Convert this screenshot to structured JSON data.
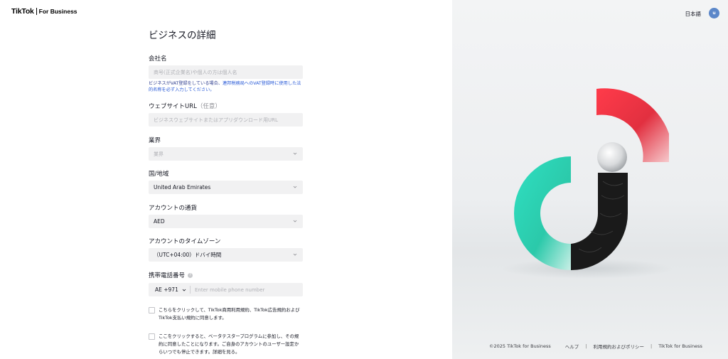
{
  "header": {
    "brand": "TikTok",
    "brand_suffix": "For Business"
  },
  "form": {
    "title": "ビジネスの詳細",
    "company": {
      "label": "会社名",
      "placeholder": "商号(正式企業名)や個人の方は個人名",
      "hint_prefix": "ビジネスがVAT登録をしている場合、",
      "hint_link": "連邦税務局へのVAT登録時に使用",
      "hint_suffix": "した法的名称を必ず入力してください。"
    },
    "website": {
      "label": "ウェブサイトURL",
      "optional": "（任意）",
      "placeholder": "ビジネスウェブサイトまたはアプリダウンロード用URL"
    },
    "industry": {
      "label": "業界",
      "placeholder": "業界"
    },
    "country": {
      "label": "国/地域",
      "value": "United Arab Emirates"
    },
    "currency": {
      "label": "アカウントの通貨",
      "value": "AED"
    },
    "timezone": {
      "label": "アカウントのタイムゾーン",
      "value": "（UTC+04:00）ドバイ時間"
    },
    "phone": {
      "label": "携帯電話番号",
      "country_code": "AE +971",
      "placeholder": "Enter mobile phone number"
    },
    "terms": {
      "text_line1": "こちらをクリックして、TikTok商用利用規約、TikTok広告規約および",
      "text_line2": "TikTok支払い規約に同意します。"
    },
    "beta": {
      "text_line1": "ここをクリックすると、ベータテスタープログラムに参加し、その規",
      "text_line2": "約に同意したことになります。ご自身のアカウントのユーザー設定か",
      "text_line3": "らいつでも停止できます。詳細を見る。"
    }
  },
  "topbar": {
    "language": "日本語",
    "avatar_initial": "u"
  },
  "footer": {
    "copyright": "©2025 TikTok for Business",
    "help": "ヘルプ",
    "sep": "|",
    "terms": "利用規約およびポリシー",
    "brand": "TikTok for Business"
  },
  "colors": {
    "red": "#e8323f",
    "teal": "#2fd6b8",
    "black": "#1a1a1a",
    "link": "#2557d6"
  }
}
